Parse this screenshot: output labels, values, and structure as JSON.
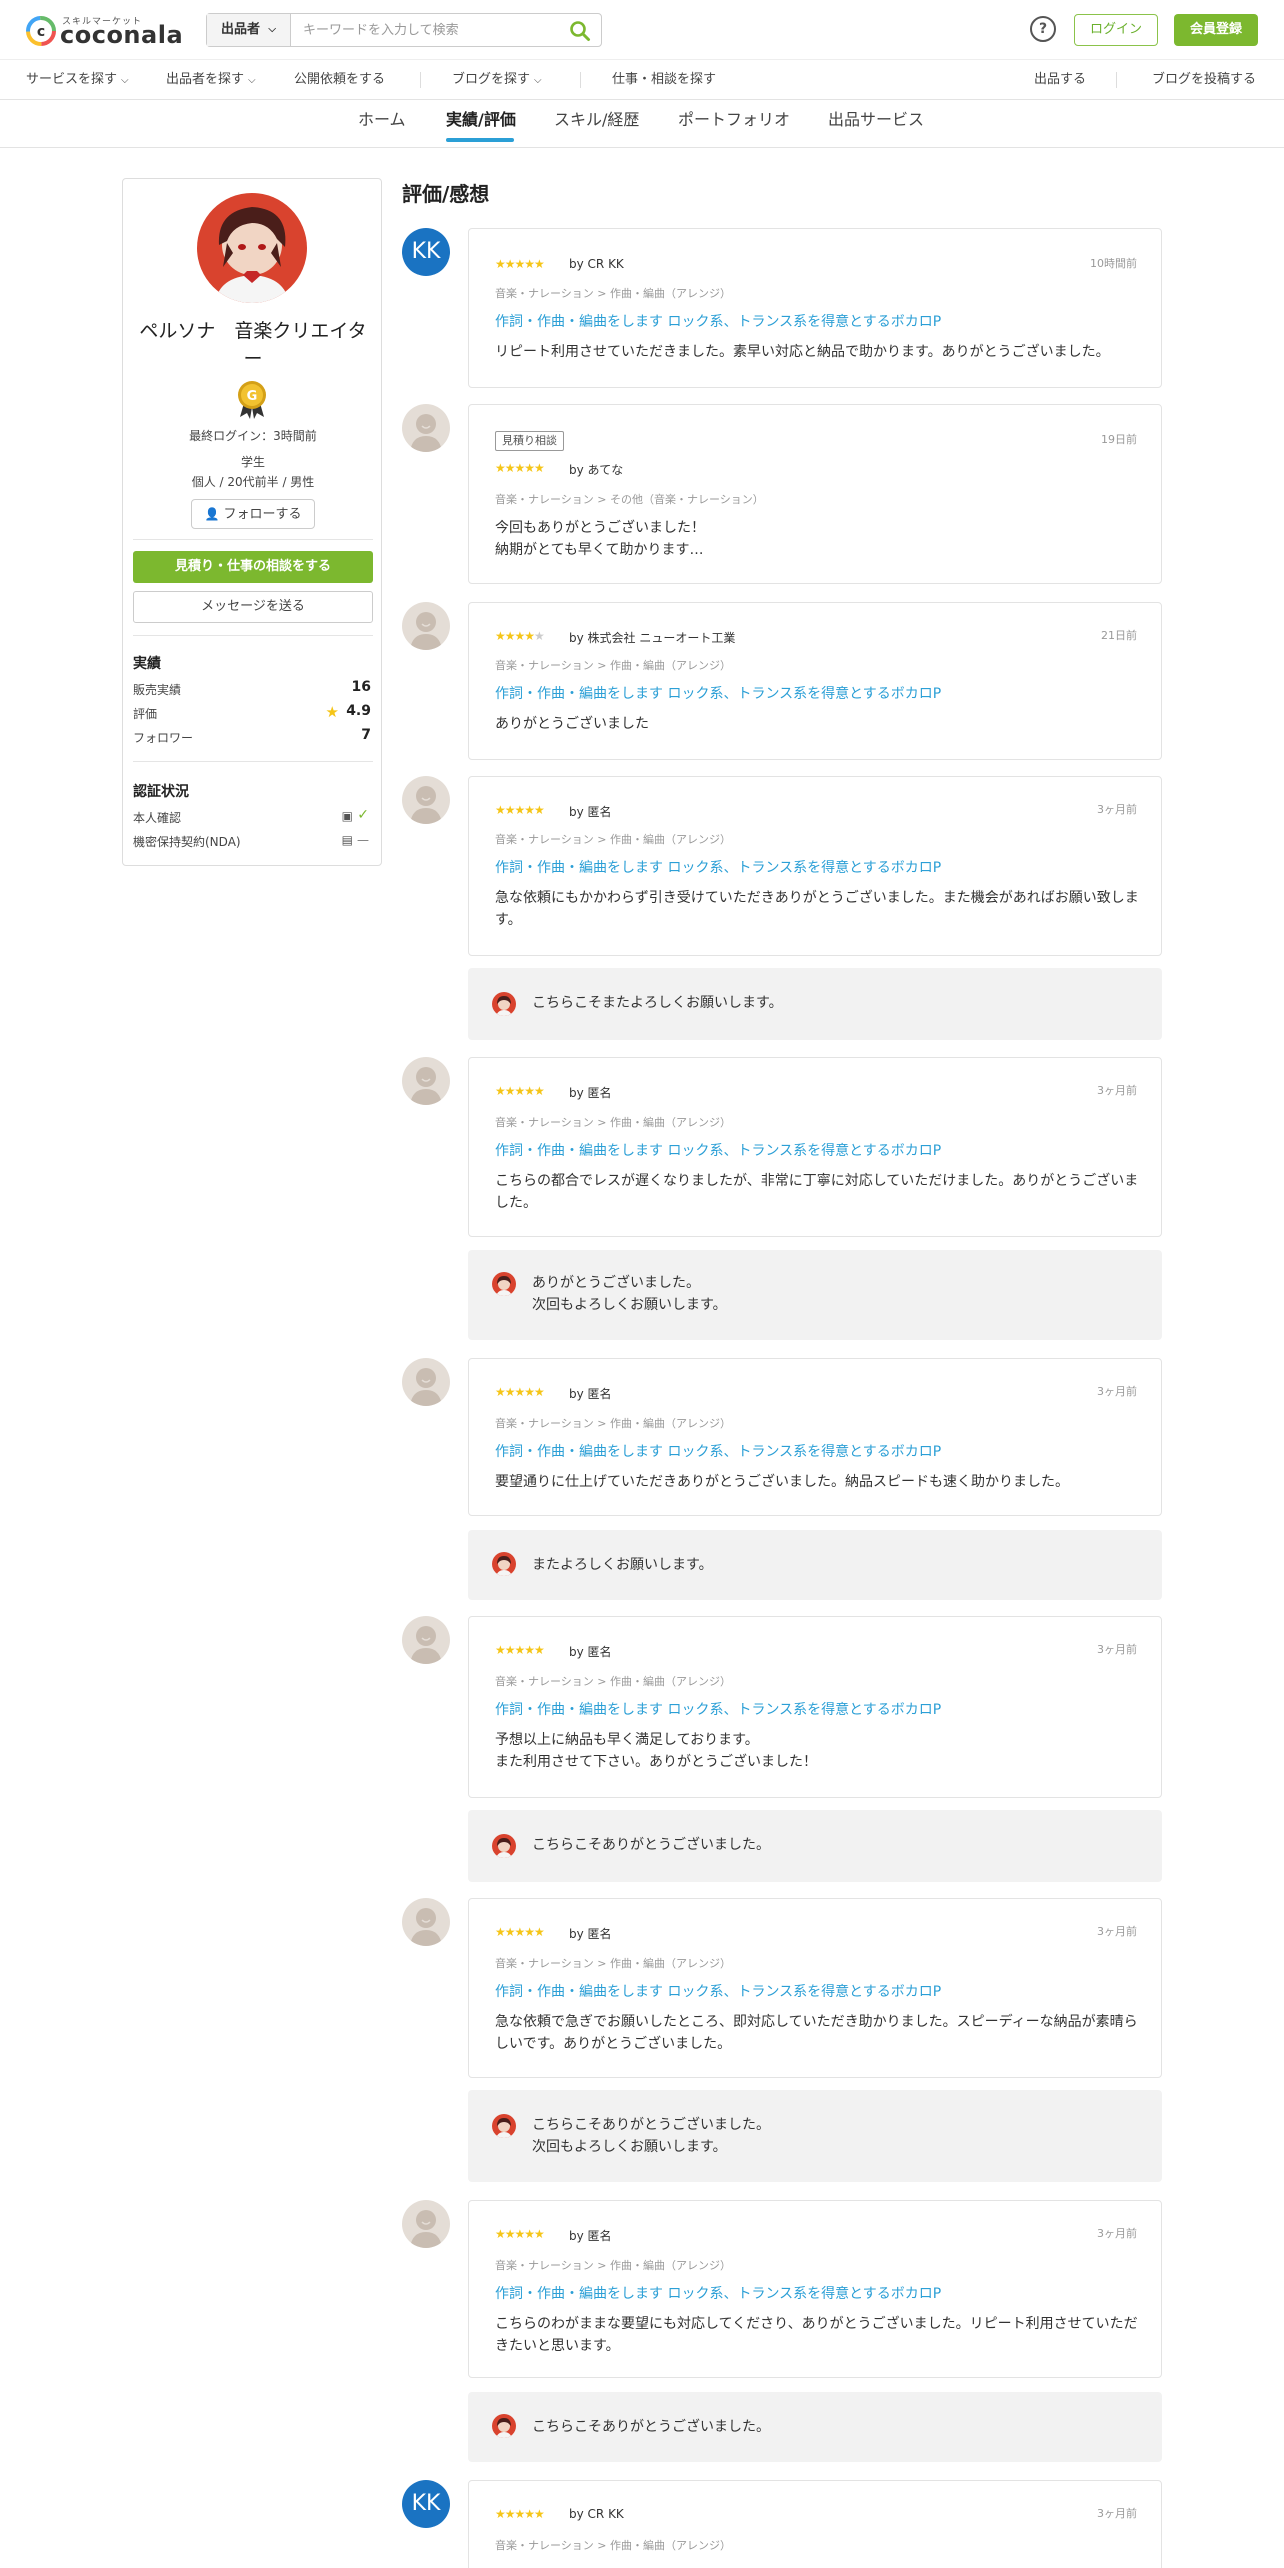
{
  "header": {
    "logo_sub": "スキルマーケット",
    "logo_main": "coconala",
    "search_type": "出品者",
    "search_placeholder": "キーワードを入力して検索",
    "help": "?",
    "login": "ログイン",
    "signup": "会員登録"
  },
  "subnav": {
    "items": [
      "サービスを探す",
      "出品者を探す",
      "公開依頼をする",
      "ブログを探す",
      "仕事・相談を探す",
      "出品する",
      "ブログを投稿する"
    ]
  },
  "tabs": [
    "ホーム",
    "実績/評価",
    "スキル/経歴",
    "ポートフォリオ",
    "出品サービス"
  ],
  "profile": {
    "name": "ペルソナ　音楽クリエイター",
    "badge": "G",
    "last_login": "最終ログイン：3時間前",
    "occupation": "学生",
    "demographics": "個人 / 20代前半 / 男性",
    "follow": "フォローする",
    "consult": "見積り・仕事の相談をする",
    "message": "メッセージを送る",
    "stats_heading": "実績",
    "sales_label": "販売実績",
    "sales_value": "16",
    "rating_label": "評価",
    "rating_value": "4.9",
    "followers_label": "フォロワー",
    "followers_value": "7",
    "verify_heading": "認証状況",
    "identity_label": "本人確認",
    "nda_label": "機密保持契約(NDA)",
    "nda_value": "—"
  },
  "main": {
    "title": "評価/感想"
  },
  "reviews": [
    {
      "avatar": "KK",
      "stars": "★★★★★",
      "off": "",
      "by": "by CR KK",
      "date": "10時間前",
      "category": "音楽・ナレーション > 作曲・編曲（アレンジ）",
      "service": "作詞・作曲・編曲をします ロック系、トランス系を得意とするボカロP",
      "comment": "リピート利用させていただきました。素早い対応と納品で助かります。ありがとうございました。"
    },
    {
      "tag": "見積り相談",
      "stars": "★★★★★",
      "off": "",
      "by": "by あてな",
      "date": "19日前",
      "category": "音楽・ナレーション > その他（音楽・ナレーション）",
      "comment": "今回もありがとうございました！\n納期がとても早くて助かります…"
    },
    {
      "stars": "★★★★",
      "off": "★",
      "by": "by 株式会社 ニューオート工業",
      "date": "21日前",
      "category": "音楽・ナレーション > 作曲・編曲（アレンジ）",
      "service": "作詞・作曲・編曲をします ロック系、トランス系を得意とするボカロP",
      "comment": "ありがとうございました"
    },
    {
      "stars": "★★★★★",
      "off": "",
      "by": "by 匿名",
      "date": "3ヶ月前",
      "category": "音楽・ナレーション > 作曲・編曲（アレンジ）",
      "service": "作詞・作曲・編曲をします ロック系、トランス系を得意とするボカロP",
      "comment": "急な依頼にもかかわらず引き受けていただきありがとうございました。また機会があればお願い致します。",
      "reply": "こちらこそまたよろしくお願いします。"
    },
    {
      "stars": "★★★★★",
      "off": "",
      "by": "by 匿名",
      "date": "3ヶ月前",
      "category": "音楽・ナレーション > 作曲・編曲（アレンジ）",
      "service": "作詞・作曲・編曲をします ロック系、トランス系を得意とするボカロP",
      "comment": "こちらの都合でレスが遅くなりましたが、非常に丁寧に対応していただけました。ありがとうございました。",
      "reply": "ありがとうございました。\n次回もよろしくお願いします。"
    },
    {
      "stars": "★★★★★",
      "off": "",
      "by": "by 匿名",
      "date": "3ヶ月前",
      "category": "音楽・ナレーション > 作曲・編曲（アレンジ）",
      "service": "作詞・作曲・編曲をします ロック系、トランス系を得意とするボカロP",
      "comment": "要望通りに仕上げていただきありがとうございました。納品スピードも速く助かりました。",
      "reply": "またよろしくお願いします。"
    },
    {
      "stars": "★★★★★",
      "off": "",
      "by": "by 匿名",
      "date": "3ヶ月前",
      "category": "音楽・ナレーション > 作曲・編曲（アレンジ）",
      "service": "作詞・作曲・編曲をします ロック系、トランス系を得意とするボカロP",
      "comment": "予想以上に納品も早く満足しております。\nまた利用させて下さい。ありがとうございました！",
      "reply": "こちらこそありがとうございました。"
    },
    {
      "stars": "★★★★★",
      "off": "",
      "by": "by 匿名",
      "date": "3ヶ月前",
      "category": "音楽・ナレーション > 作曲・編曲（アレンジ）",
      "service": "作詞・作曲・編曲をします ロック系、トランス系を得意とするボカロP",
      "comment": "急な依頼で急ぎでお願いしたところ、即対応していただき助かりました。スピーディーな納品が素晴らしいです。ありがとうございました。",
      "reply": "こちらこそありがとうございました。\n次回もよろしくお願いします。"
    },
    {
      "stars": "★★★★★",
      "off": "",
      "by": "by 匿名",
      "date": "3ヶ月前",
      "category": "音楽・ナレーション > 作曲・編曲（アレンジ）",
      "service": "作詞・作曲・編曲をします ロック系、トランス系を得意とするボカロP",
      "comment": "こちらのわがままな要望にも対応してくださり、ありがとうございました。リピート利用させていただきたいと思います。",
      "reply": "こちらこそありがとうございました。"
    },
    {
      "avatar": "KK",
      "stars": "★★★★★",
      "off": "",
      "by": "by CR KK",
      "date": "3ヶ月前",
      "category": "音楽・ナレーション > 作曲・編曲（アレンジ）"
    }
  ]
}
